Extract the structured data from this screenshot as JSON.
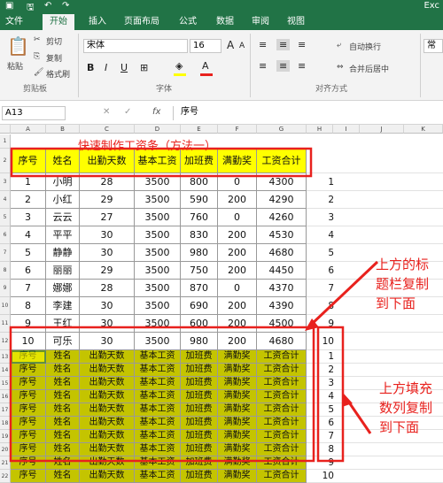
{
  "app": {
    "title": "Exc"
  },
  "quick_access": [
    "save-icon",
    "undo-icon",
    "redo-icon"
  ],
  "tabs": [
    "文件",
    "开始",
    "插入",
    "页面布局",
    "公式",
    "数据",
    "审阅",
    "视图"
  ],
  "ribbon": {
    "clipboard": {
      "paste": "粘贴",
      "cut": "剪切",
      "copy": "复制",
      "format_painter": "格式刷",
      "group": "剪贴板"
    },
    "font": {
      "name": "宋体",
      "size": "16",
      "bold": "B",
      "italic": "I",
      "underline": "U",
      "group": "字体",
      "aa_up": "A",
      "aa_down": "A",
      "fill_color": "#ffff00",
      "font_color": "#e8211d"
    },
    "alignment": {
      "wrap": "自动换行",
      "merge": "合并后居中",
      "group": "对齐方式"
    },
    "number": {
      "format": "常规"
    }
  },
  "formula_bar": {
    "name_box": "A13",
    "fx": "fx",
    "content": "序号"
  },
  "columns": [
    "A",
    "B",
    "C",
    "D",
    "E",
    "F",
    "G",
    "H",
    "I",
    "J",
    "K"
  ],
  "rows": [
    "1",
    "2",
    "3",
    "4",
    "5",
    "6",
    "7",
    "8",
    "9",
    "10",
    "11",
    "12",
    "13",
    "14",
    "15",
    "16",
    "17",
    "18",
    "19",
    "20",
    "21",
    "22"
  ],
  "sheet": {
    "title": "快速制作工资条（方法一）",
    "header": [
      "序号",
      "姓名",
      "出勤天数",
      "基本工资",
      "加班费",
      "满勤奖",
      "工资合计"
    ],
    "data": [
      [
        "1",
        "小明",
        "28",
        "3500",
        "800",
        "0",
        "4300"
      ],
      [
        "2",
        "小红",
        "29",
        "3500",
        "590",
        "200",
        "4290"
      ],
      [
        "3",
        "云云",
        "27",
        "3500",
        "760",
        "0",
        "4260"
      ],
      [
        "4",
        "平平",
        "30",
        "3500",
        "830",
        "200",
        "4530"
      ],
      [
        "5",
        "静静",
        "30",
        "3500",
        "980",
        "200",
        "4680"
      ],
      [
        "6",
        "丽丽",
        "29",
        "3500",
        "750",
        "200",
        "4450"
      ],
      [
        "7",
        "娜娜",
        "28",
        "3500",
        "870",
        "0",
        "4370"
      ],
      [
        "8",
        "李建",
        "30",
        "3500",
        "690",
        "200",
        "4390"
      ],
      [
        "9",
        "王红",
        "30",
        "3500",
        "600",
        "200",
        "4500"
      ],
      [
        "10",
        "可乐",
        "30",
        "3500",
        "980",
        "200",
        "4680"
      ]
    ],
    "helper_top": [
      "1",
      "2",
      "3",
      "4",
      "5",
      "6",
      "7",
      "8",
      "9",
      "10"
    ],
    "helper_bottom": [
      "1",
      "2",
      "3",
      "4",
      "5",
      "6",
      "7",
      "8",
      "9",
      "10"
    ]
  },
  "annotations": {
    "top": "上方的标题栏复制到下面",
    "bottom": "上方填充数列复制到下面"
  },
  "colors": {
    "excel_green": "#217346",
    "annotation_red": "#e8211d",
    "highlight_yellow": "#ffff00",
    "olive_fill": "#c4c400"
  }
}
